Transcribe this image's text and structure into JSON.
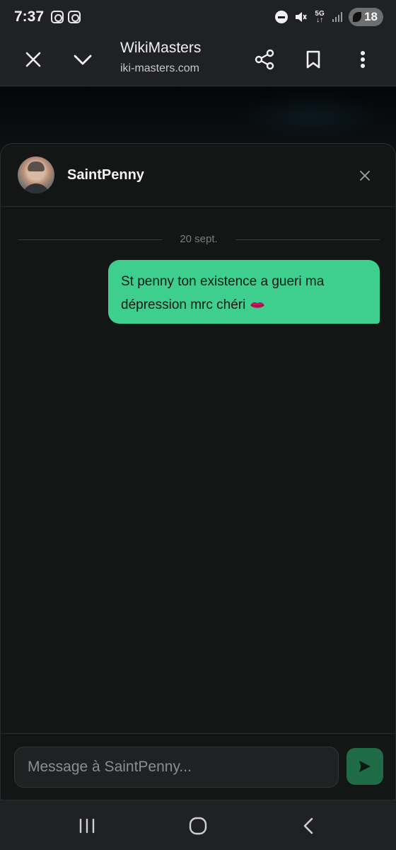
{
  "status_bar": {
    "time": "7:37",
    "network": "5G",
    "battery": "18",
    "icons": [
      "instagram-icon",
      "instagram-icon",
      "do-not-disturb-icon",
      "mute-icon",
      "5g-icon",
      "signal-icon",
      "battery-icon"
    ]
  },
  "browser": {
    "title": "WikiMasters",
    "url": "iki-masters.com",
    "icons": [
      "close-icon",
      "chevron-down-icon",
      "share-icon",
      "bookmark-icon",
      "more-vert-icon"
    ]
  },
  "chat": {
    "contact_name": "SaintPenny",
    "date_label": "20 sept.",
    "messages": [
      {
        "text": "St penny ton existence a gueri ma dépression mrc chéri",
        "emoji": "kiss-lips-icon",
        "outgoing": true
      }
    ],
    "input_placeholder": "Message à SaintPenny...",
    "accent_color": "#3ecf8e",
    "send_button_color": "#1f6b48"
  },
  "nav_bar": {
    "icons": [
      "recents-icon",
      "home-icon",
      "back-icon"
    ]
  }
}
